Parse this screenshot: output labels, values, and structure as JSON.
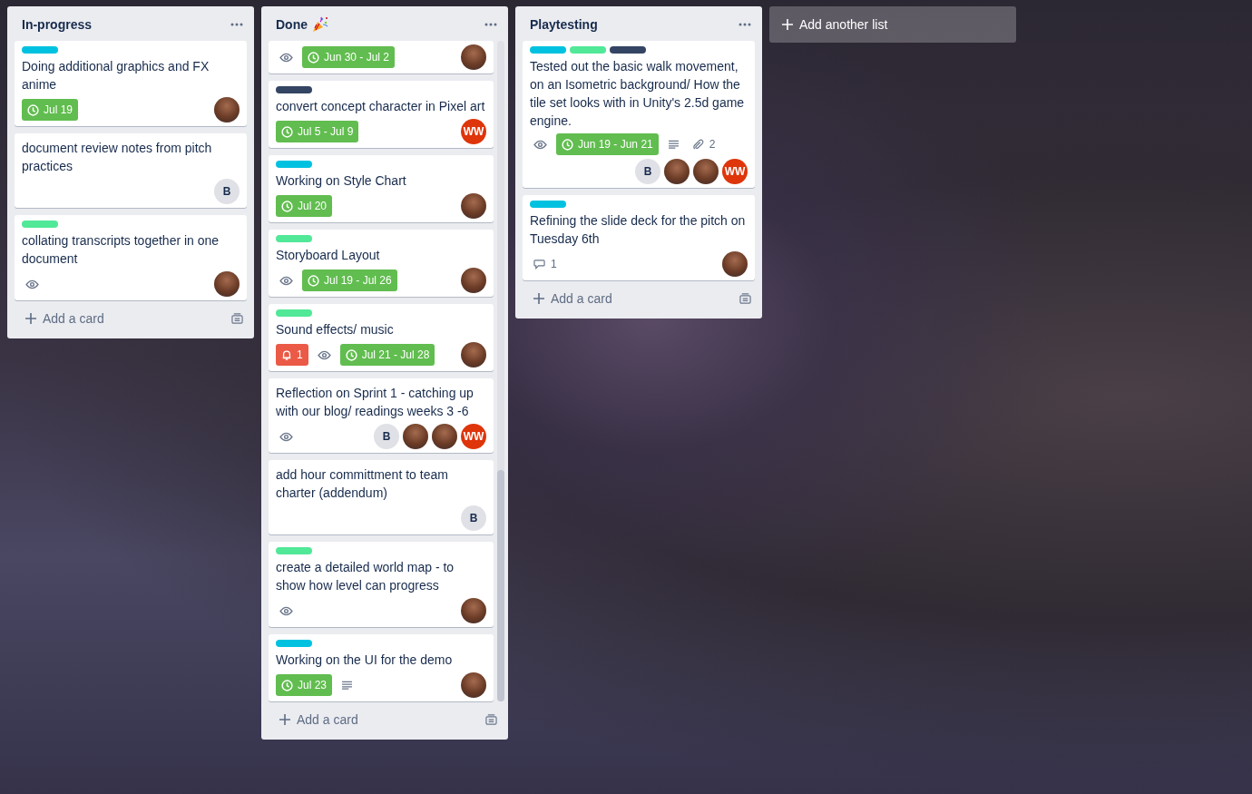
{
  "lists": [
    {
      "title": "In-progress",
      "has_icon": false,
      "scrolled": false,
      "cards": [
        {
          "labels": [
            {
              "color": "#00c2e0"
            }
          ],
          "title": "Doing additional graphics and FX anime",
          "badges": [
            {
              "kind": "due",
              "text": "Jul 19"
            }
          ],
          "members": [
            {
              "kind": "photo"
            }
          ]
        },
        {
          "title": "document review notes from pitch practices",
          "members": [
            {
              "kind": "initials",
              "text": "B",
              "color": "#dfe1e6"
            }
          ]
        },
        {
          "labels": [
            {
              "color": "#51e898"
            }
          ],
          "title": "collating transcripts together in one document",
          "badges": [
            {
              "kind": "watch"
            }
          ],
          "members": [
            {
              "kind": "photo"
            }
          ]
        }
      ],
      "add_label": "Add a card"
    },
    {
      "title": "Done",
      "has_icon": true,
      "scrolled": true,
      "cards": [
        {
          "badges": [
            {
              "kind": "watch"
            },
            {
              "kind": "due",
              "text": "Jun 30 - Jul 2"
            }
          ],
          "members": [
            {
              "kind": "photo"
            }
          ]
        },
        {
          "labels": [
            {
              "color": "#344563"
            }
          ],
          "title": "convert concept character in Pixel art",
          "badges": [
            {
              "kind": "due",
              "text": "Jul 5 - Jul 9"
            }
          ],
          "members": [
            {
              "kind": "initials",
              "text": "WW",
              "color": "#de350b"
            }
          ]
        },
        {
          "labels": [
            {
              "color": "#00c2e0"
            }
          ],
          "title": "Working on Style Chart",
          "badges": [
            {
              "kind": "due",
              "text": "Jul 20"
            }
          ],
          "members": [
            {
              "kind": "photo"
            }
          ]
        },
        {
          "labels": [
            {
              "color": "#51e898"
            }
          ],
          "title": "Storyboard Layout",
          "badges": [
            {
              "kind": "watch"
            },
            {
              "kind": "due",
              "text": "Jul 19 - Jul 26"
            }
          ],
          "members": [
            {
              "kind": "photo"
            }
          ]
        },
        {
          "labels": [
            {
              "color": "#51e898"
            }
          ],
          "title": "Sound effects/ music",
          "badges": [
            {
              "kind": "alert",
              "text": "1"
            },
            {
              "kind": "watch"
            },
            {
              "kind": "due",
              "text": "Jul 21 - Jul 28"
            }
          ],
          "members": [
            {
              "kind": "photo"
            }
          ]
        },
        {
          "title": "Reflection on Sprint 1 - catching up with our blog/ readings weeks 3 -6",
          "badges": [
            {
              "kind": "watch"
            }
          ],
          "members": [
            {
              "kind": "initials",
              "text": "B",
              "color": "#dfe1e6"
            },
            {
              "kind": "photo"
            },
            {
              "kind": "photo"
            },
            {
              "kind": "initials",
              "text": "WW",
              "color": "#de350b"
            }
          ]
        },
        {
          "title": "add hour committment to team charter (addendum)",
          "members": [
            {
              "kind": "initials",
              "text": "B",
              "color": "#dfe1e6"
            }
          ]
        },
        {
          "labels": [
            {
              "color": "#51e898"
            }
          ],
          "title": "create a detailed world map - to show how level can progress",
          "badges": [
            {
              "kind": "watch"
            }
          ],
          "members": [
            {
              "kind": "photo"
            }
          ]
        },
        {
          "labels": [
            {
              "color": "#00c2e0"
            }
          ],
          "title": "Working on the UI for the demo",
          "badges": [
            {
              "kind": "due",
              "text": "Jul 23"
            },
            {
              "kind": "description"
            }
          ],
          "members": [
            {
              "kind": "photo"
            }
          ]
        }
      ],
      "add_label": "Add a card"
    },
    {
      "title": "Playtesting",
      "has_icon": false,
      "scrolled": false,
      "cards": [
        {
          "labels": [
            {
              "color": "#00c2e0"
            },
            {
              "color": "#51e898"
            },
            {
              "color": "#344563"
            }
          ],
          "title": "Tested out the basic walk movement, on an Isometric background/ How the tile set looks with in Unity's 2.5d game engine.",
          "badges": [
            {
              "kind": "watch"
            },
            {
              "kind": "due",
              "text": "Jun 19 - Jun 21"
            },
            {
              "kind": "description"
            },
            {
              "kind": "attachments",
              "text": "2"
            }
          ],
          "members": [
            {
              "kind": "initials",
              "text": "B",
              "color": "#dfe1e6"
            },
            {
              "kind": "photo"
            },
            {
              "kind": "photo"
            },
            {
              "kind": "initials",
              "text": "WW",
              "color": "#de350b"
            }
          ]
        },
        {
          "labels": [
            {
              "color": "#00c2e0"
            }
          ],
          "title": "Refining the slide deck for the pitch on Tuesday 6th",
          "badges": [
            {
              "kind": "comments",
              "text": "1"
            }
          ],
          "members": [
            {
              "kind": "photo"
            }
          ]
        }
      ],
      "add_label": "Add a card"
    }
  ],
  "add_list": "Add another list"
}
